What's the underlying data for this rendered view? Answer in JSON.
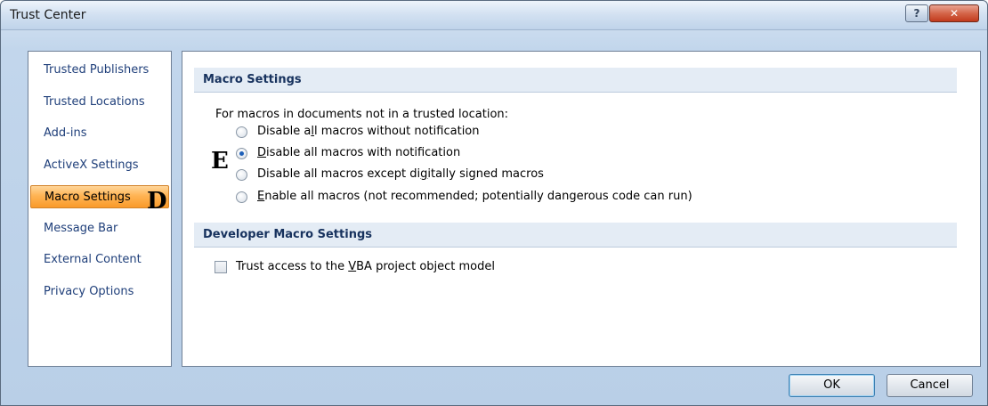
{
  "window": {
    "title": "Trust Center",
    "help_glyph": "?",
    "close_glyph": "✕"
  },
  "nav": {
    "items": [
      {
        "label": "Trusted Publishers"
      },
      {
        "label": "Trusted Locations"
      },
      {
        "label": "Add-ins"
      },
      {
        "label": "ActiveX Settings"
      },
      {
        "label": "Macro Settings",
        "selected": true
      },
      {
        "label": "Message Bar"
      },
      {
        "label": "External Content"
      },
      {
        "label": "Privacy Options"
      }
    ],
    "annotation_letter": "D"
  },
  "macro_settings": {
    "header": "Macro Settings",
    "intro": "For macros in documents not in a trusted location:",
    "annotation_letter": "E",
    "options": [
      {
        "pre": "Disable a",
        "key": "l",
        "post": "l macros without notification",
        "checked": false
      },
      {
        "pre": "",
        "key": "D",
        "post": "isable all macros with notification",
        "checked": true
      },
      {
        "pre": "Disable all macros except di",
        "key": "g",
        "post": "itally signed macros",
        "checked": false
      },
      {
        "pre": "",
        "key": "E",
        "post": "nable all macros (not recommended; potentially dangerous code can run)",
        "checked": false
      }
    ]
  },
  "developer_settings": {
    "header": "Developer Macro Settings",
    "trust_vba": {
      "pre": "Trust access to the ",
      "key": "V",
      "post": "BA project object model",
      "checked": false
    }
  },
  "buttons": {
    "ok": "OK",
    "cancel": "Cancel"
  },
  "colors": {
    "selected_item": "#ffb454",
    "nav_text": "#1f3f7a",
    "header_bg": "#e4ecf5"
  }
}
